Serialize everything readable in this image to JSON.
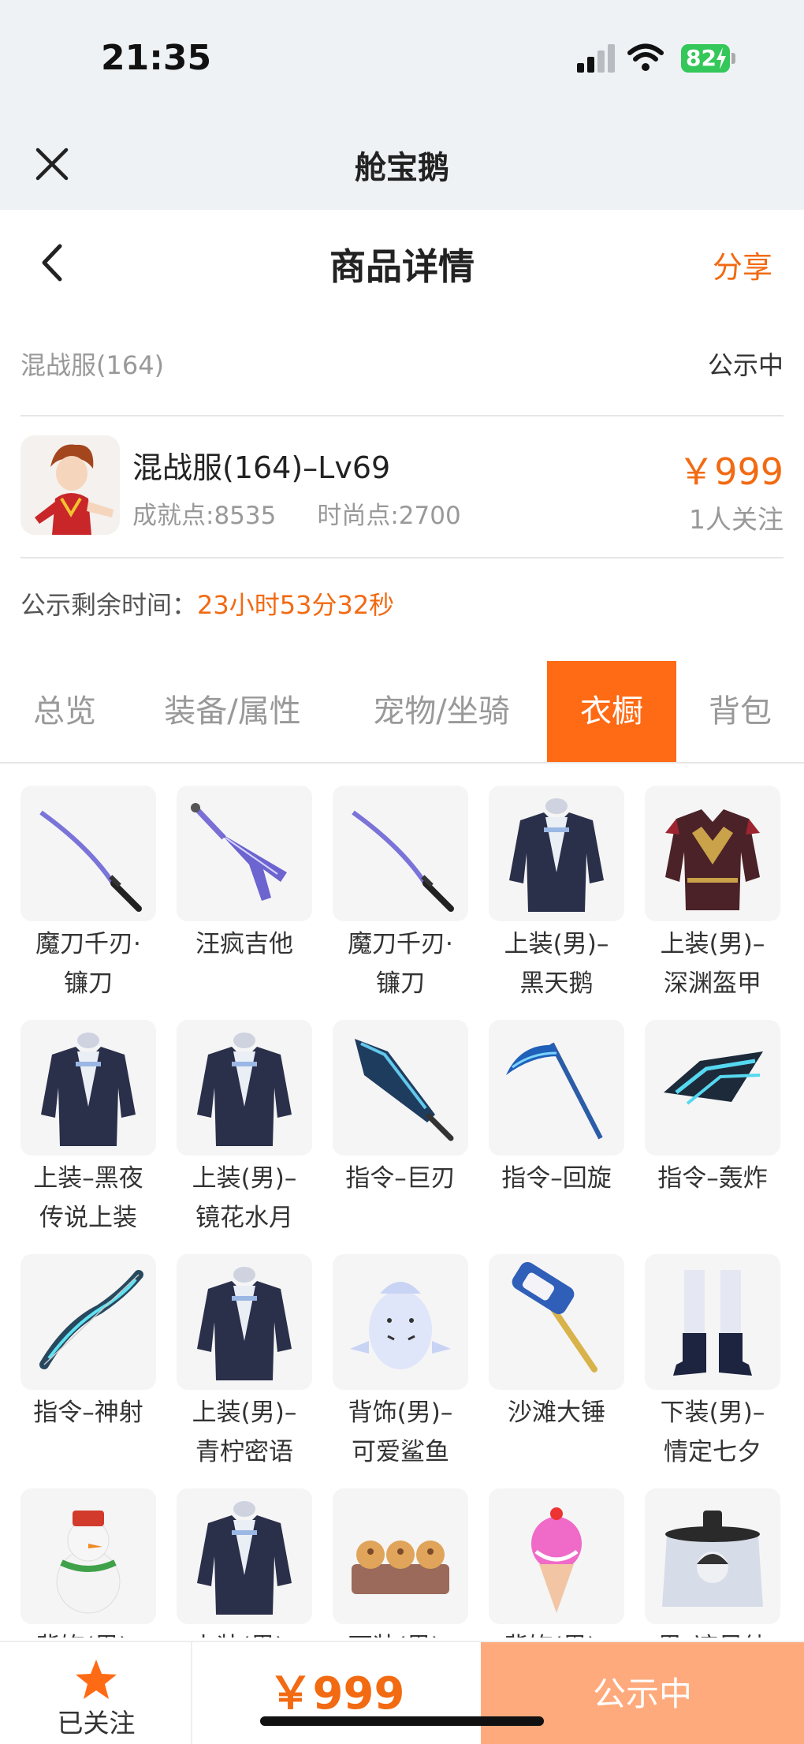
{
  "status_bar": {
    "time": "21:35",
    "battery": "82"
  },
  "app": {
    "title": "舱宝鹅"
  },
  "page": {
    "title": "商品详情",
    "share": "分享"
  },
  "listing": {
    "server": "混战服(164)",
    "status": "公示中",
    "name": "混战服(164)–Lv69",
    "achievement": "成就点:8535",
    "fashion": "时尚点:2700",
    "price": "￥999",
    "followers": "1人关注",
    "countdown_label": "公示剩余时间：",
    "countdown_value": "23小时53分32秒"
  },
  "tabs": [
    {
      "label": "总览",
      "active": false
    },
    {
      "label": "装备/属性",
      "active": false
    },
    {
      "label": "宠物/坐骑",
      "active": false
    },
    {
      "label": "衣橱",
      "active": true
    },
    {
      "label": "背包",
      "active": false
    }
  ],
  "items": [
    {
      "name": "魔刀千刃·\n镰刀",
      "icon": "katana-icon"
    },
    {
      "name": "汪疯吉他",
      "icon": "guitar-icon"
    },
    {
      "name": "魔刀千刃·\n镰刀",
      "icon": "katana-icon"
    },
    {
      "name": "上装(男)–\n黑天鹅",
      "icon": "coat-icon"
    },
    {
      "name": "上装(男)–\n深渊盔甲",
      "icon": "armor-icon"
    },
    {
      "name": "上装–黑夜\n传说上装",
      "icon": "coat-icon"
    },
    {
      "name": "上装(男)–\n镜花水月",
      "icon": "coat-icon"
    },
    {
      "name": "指令–巨刃",
      "icon": "blade-icon"
    },
    {
      "name": "指令–回旋",
      "icon": "scythe-icon"
    },
    {
      "name": "指令–轰炸",
      "icon": "drone-icon"
    },
    {
      "name": "指令–神射",
      "icon": "bow-icon"
    },
    {
      "name": "上装(男)–\n青柠密语",
      "icon": "coat-icon"
    },
    {
      "name": "背饰(男)–\n可爱鲨鱼",
      "icon": "shark-icon"
    },
    {
      "name": "沙滩大锤",
      "icon": "hammer-icon"
    },
    {
      "name": "下装(男)–\n情定七夕",
      "icon": "boots-icon"
    },
    {
      "name": "背饰(男)–",
      "icon": "snowman-icon"
    },
    {
      "name": "上装(男)–",
      "icon": "coat-icon"
    },
    {
      "name": "下装(男)–",
      "icon": "buns-icon"
    },
    {
      "name": "背饰(男)–",
      "icon": "icecream-icon"
    },
    {
      "name": "男–凉风纱",
      "icon": "veil-hat-icon"
    }
  ],
  "bottom_bar": {
    "followed": "已关注",
    "price": "￥999",
    "cta": "公示中"
  },
  "colors": {
    "accent": "#f26a12",
    "active_tab": "#ff6a14",
    "cta_bg": "#ffaa7c"
  }
}
